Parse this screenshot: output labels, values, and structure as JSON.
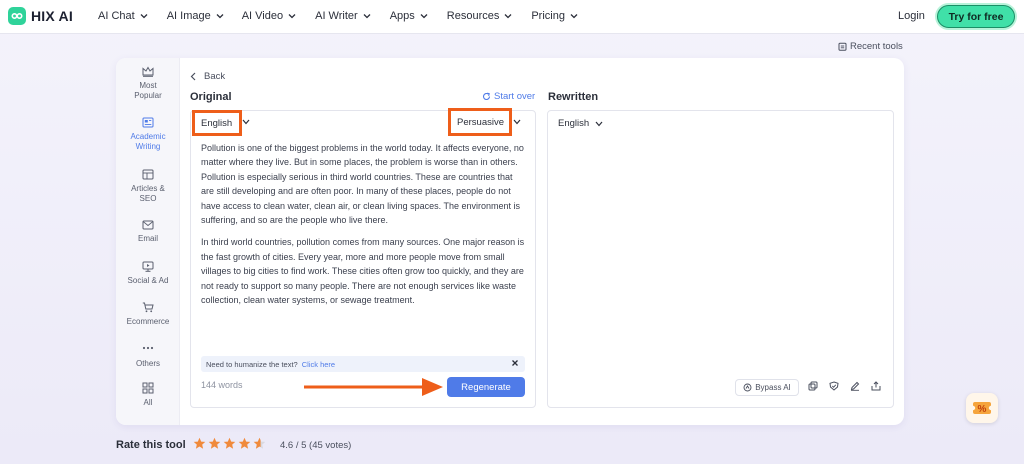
{
  "brand": {
    "name": "HIX AI"
  },
  "nav": {
    "items": [
      "AI Chat",
      "AI Image",
      "AI Video",
      "AI Writer",
      "Apps",
      "Resources",
      "Pricing"
    ],
    "login": "Login",
    "cta": "Try for free"
  },
  "recent_tools": "Recent tools",
  "sidebar": {
    "items": [
      {
        "label": "Most Popular",
        "icon": "crown-icon"
      },
      {
        "label": "Academic Writing",
        "icon": "document-icon",
        "active": true
      },
      {
        "label": "Articles & SEO",
        "icon": "article-icon"
      },
      {
        "label": "Email",
        "icon": "mail-icon"
      },
      {
        "label": "Social & Ad",
        "icon": "monitor-icon"
      },
      {
        "label": "Ecommerce",
        "icon": "cart-icon"
      },
      {
        "label": "Others",
        "icon": "dots-icon"
      },
      {
        "label": "All",
        "icon": "grid-icon"
      }
    ]
  },
  "editor": {
    "back": "Back",
    "original_title": "Original",
    "start_over": "Start over",
    "rewritten_title": "Rewritten",
    "language": "English",
    "tone": "Persuasive",
    "output_language": "English",
    "paragraphs": [
      "Pollution is one of the biggest problems in the world today. It affects everyone, no matter where they live. But in some places, the problem is worse than in others. Pollution is especially serious in third world countries. These are countries that are still developing and are often poor. In many of these places, people do not have access to clean water, clean air, or clean living spaces. The environment is suffering, and so are the people who live there.",
      "In third world countries, pollution comes from many sources. One major reason is the fast growth of cities. Every year, more and more people move from small villages to big cities to find work. These cities often grow too quickly, and they are not ready to support so many people. There are not enough services like waste collection, clean water systems, or sewage treatment."
    ],
    "humanize_text": "Need to humanize the text?",
    "humanize_link": "Click here",
    "word_count": "144 words",
    "regenerate": "Regenerate",
    "bypass": "Bypass AI"
  },
  "rating": {
    "label": "Rate this tool",
    "value": "4.6 / 5 (45 votes)",
    "stars": 4.6
  },
  "colors": {
    "accent": "#4f7be8",
    "highlight": "#ee5e1a",
    "cta": "#40e0a8",
    "star": "#f08a3c"
  }
}
